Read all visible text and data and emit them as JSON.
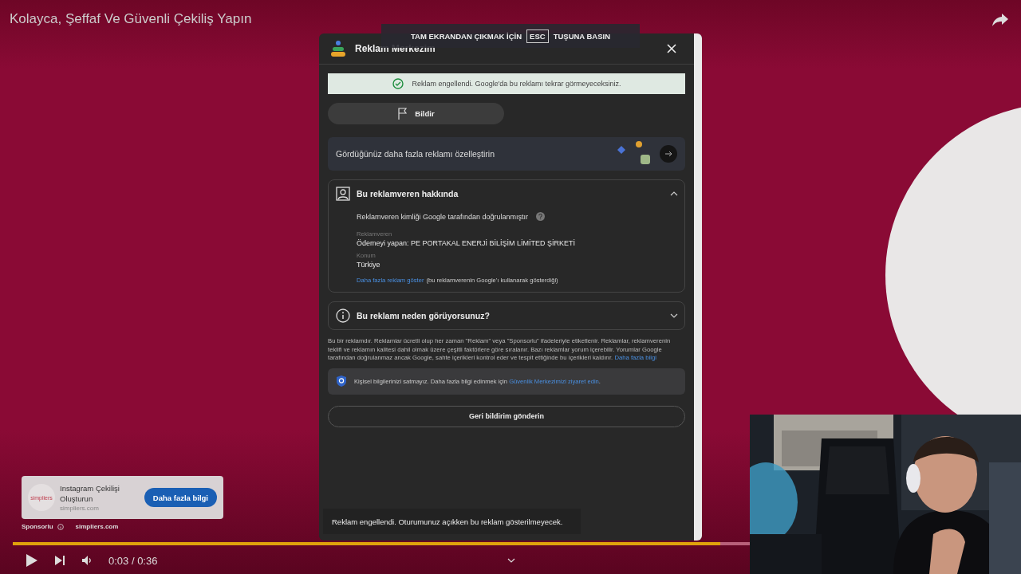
{
  "video": {
    "title": "Kolayca, Şeffaf Ve Güvenli Çekiliş Yapın"
  },
  "fullscreen_notice": {
    "before": "TAM EKRANDAN ÇIKMAK İÇİN",
    "key": "ESC",
    "after": "TUŞUNA BASIN"
  },
  "ad_center": {
    "title": "Reklam Merkezim",
    "banner": "Reklam engellendi. Google'da bu reklamı tekrar görmeyeceksiniz.",
    "report_button": "Bildir",
    "customize": "Gördüğünüz daha fazla reklamı özelleştirin",
    "sections": [
      {
        "kind": "advertiser",
        "title": "Bu reklamveren hakkında",
        "expanded": true,
        "verified": "Reklamveren kimliği Google tarafından doğrulanmıştır",
        "fields": [
          {
            "label": "Reklamveren",
            "value": "Ödemeyi yapan: PE PORTAKAL ENERJİ BİLİŞİM LİMİTED ŞİRKETİ"
          },
          {
            "label": "Konum",
            "value": "Türkiye"
          }
        ],
        "link": "Daha fazla reklam göster",
        "link_note": "(bu reklamverenin Google'ı kullanarak gösterdiği)"
      },
      {
        "kind": "why",
        "title": "Bu reklamı neden görüyorsunuz?",
        "expanded": false
      }
    ],
    "disclosure": "Bu bir reklamdır. Reklamlar ücretli olup her zaman \"Reklam\" veya \"Sponsorlu\" ifadeleriyle etiketlenir. Reklamlar, reklamverenin teklifi ve reklamın kalitesi dahil olmak üzere çeşitli faktörlere göre sıralanır. Bazı reklamlar yorum içerebilir. Yorumlar Google tarafından doğrulanmaz ancak Google, sahte içerikleri kontrol eder ve tespit ettiğinde bu içerikleri kaldırır.",
    "disclosure_link": "Daha fazla bilgi",
    "privacy": "Kişisel bilgilerinizi satmayız. Daha fazla bilgi edinmek için",
    "privacy_link": "Güvenlik Merkezimizi ziyaret edin",
    "privacy_end": ".",
    "feedback_button": "Geri bildirim gönderin",
    "toast": "Reklam engellendi. Oturumunuz açıkken bu reklam gösterilmeyecek."
  },
  "ad_card": {
    "logo": "simpliers",
    "title": "Instagram Çekilişi Oluşturun",
    "domain": "simpliers.com",
    "button": "Daha fazla bilgi",
    "sponsored": "Sponsorlu",
    "advertiser": "simpliers.com"
  },
  "player": {
    "level": 0.96,
    "time": "0:03 / 0:36"
  }
}
